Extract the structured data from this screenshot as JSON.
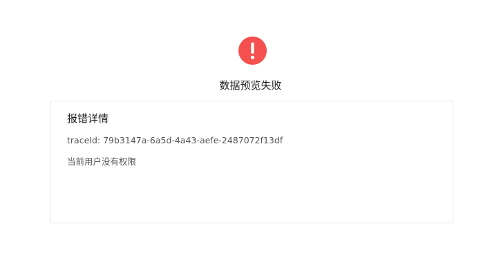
{
  "status": {
    "icon": "exclamation-icon",
    "icon_color": "#f5504f",
    "title": "数据预览失败"
  },
  "details": {
    "heading": "报错详情",
    "trace_label": "traceId:",
    "trace_id": "79b3147a-6a5d-4a43-aefe-2487072f13df",
    "message": "当前用户没有权限"
  }
}
